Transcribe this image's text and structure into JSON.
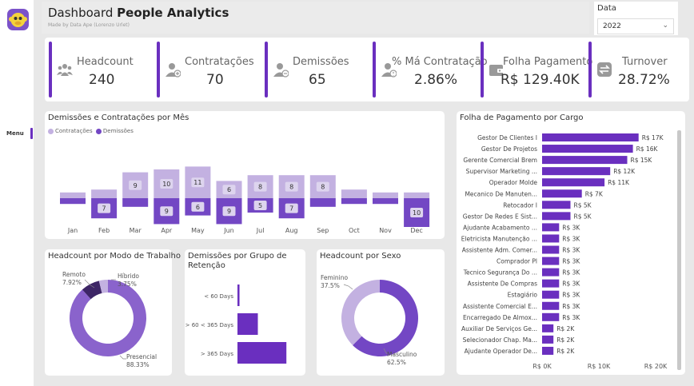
{
  "header": {
    "title_pre": "Dashboard",
    "title_bold": "People Analytics",
    "subtitle": "Made by Data Ape (Lorenzo Urlet)"
  },
  "sidebar": {
    "menu_label": "Menu"
  },
  "filter": {
    "label": "Data",
    "value": "2022"
  },
  "colors": {
    "accent": "#6a2fbf",
    "light": "#c3b1e1",
    "dark": "#7b52c9",
    "label_bg": "#ddd4ee"
  },
  "kpis": [
    {
      "label": "Headcount",
      "value": "240",
      "icon": "people-group-icon"
    },
    {
      "label": "Contratações",
      "value": "70",
      "icon": "user-add-icon"
    },
    {
      "label": "Demissões",
      "value": "65",
      "icon": "user-remove-icon"
    },
    {
      "label": "% Má Contratação",
      "value": "2.86%",
      "icon": "user-warning-icon"
    },
    {
      "label": "Folha Pagamento",
      "value": "R$ 129.40K",
      "icon": "wallet-icon"
    },
    {
      "label": "Turnover",
      "value": "28.72%",
      "icon": "swap-arrows-icon"
    }
  ],
  "monthly": {
    "title": "Demissões e Contratações por Mês",
    "legend": [
      "Contratações",
      "Demissões"
    ],
    "chart_data": {
      "type": "bar",
      "categories": [
        "Jan",
        "Feb",
        "Mar",
        "Apr",
        "May",
        "Jun",
        "Jul",
        "Aug",
        "Sep",
        "Oct",
        "Nov",
        "Dec"
      ],
      "series": [
        {
          "name": "Contratações",
          "values": [
            2,
            3,
            9,
            10,
            11,
            6,
            8,
            8,
            8,
            3,
            2,
            2
          ]
        },
        {
          "name": "Demissões",
          "values": [
            2,
            7,
            3,
            9,
            6,
            9,
            5,
            7,
            3,
            2,
            2,
            10
          ]
        }
      ],
      "labels_pos": [
        null,
        null,
        "9",
        "10",
        "11",
        "6",
        "8",
        "8",
        "8",
        null,
        null,
        null
      ],
      "labels_neg": [
        null,
        "7",
        null,
        "9",
        "6",
        "9",
        "5",
        "7",
        null,
        null,
        null,
        "10"
      ]
    }
  },
  "payroll": {
    "title": "Folha de Pagamento por Cargo",
    "chart_data": {
      "type": "bar",
      "categories": [
        "Gestor De Clientes I",
        "Gestor De Projetos",
        "Gerente Comercial Brem",
        "Supervisor Marketing ...",
        "Operador Molde",
        "Mecanico De Manuten...",
        "Retocador I",
        "Gestor De Redes E Sist...",
        "Ajudante Acabamento ...",
        "Eletricista Manutenção ...",
        "Assistente Adm. Comer...",
        "Comprador Pl",
        "Tecnico Segurança Do ...",
        "Assistente De Compras",
        "Estagiário",
        "Assistente Comercial E...",
        "Encarregado De Almox...",
        "Auxiliar De Serviços Ge...",
        "Selecionador Chap. Ma...",
        "Ajudante Operador De..."
      ],
      "values": [
        17,
        16,
        15,
        12,
        11,
        7,
        5,
        5,
        3,
        3,
        3,
        3,
        3,
        3,
        3,
        3,
        3,
        2,
        2,
        2
      ],
      "value_labels": [
        "R$ 17K",
        "R$ 16K",
        "R$ 15K",
        "R$ 12K",
        "R$ 11K",
        "R$ 7K",
        "R$ 5K",
        "R$ 5K",
        "R$ 3K",
        "R$ 3K",
        "R$ 3K",
        "R$ 3K",
        "R$ 3K",
        "R$ 3K",
        "R$ 3K",
        "R$ 3K",
        "R$ 3K",
        "R$ 2K",
        "R$ 2K",
        "R$ 2K"
      ],
      "xlim": [
        0,
        20
      ],
      "ticks": [
        "R$ 0K",
        "R$ 10K",
        "R$ 20K"
      ]
    }
  },
  "work_mode": {
    "title": "Headcount por Modo de Trabalho",
    "chart_data": {
      "type": "pie",
      "labels": [
        "Presencial",
        "Remoto",
        "Híbrido"
      ],
      "values": [
        88.33,
        7.92,
        3.75
      ],
      "value_labels": [
        "88.33%",
        "7.92%",
        "3.75%"
      ],
      "colors": [
        "#8a63cc",
        "#3d2566",
        "#c3b1e1"
      ]
    }
  },
  "retention": {
    "title_line1": "Demissões por Grupo de",
    "title_line2": "Retenção",
    "chart_data": {
      "type": "bar",
      "categories": [
        "< 60 Days",
        "> 60 < 365 Days",
        "> 365 Days"
      ],
      "values": [
        1,
        10,
        24
      ]
    }
  },
  "gender": {
    "title": "Headcount por Sexo",
    "chart_data": {
      "type": "pie",
      "labels": [
        "Masculino",
        "Feminino"
      ],
      "values": [
        62.5,
        37.5
      ],
      "value_labels": [
        "62.5%",
        "37.5%"
      ],
      "colors": [
        "#7347c4",
        "#c3b1e1"
      ]
    }
  }
}
